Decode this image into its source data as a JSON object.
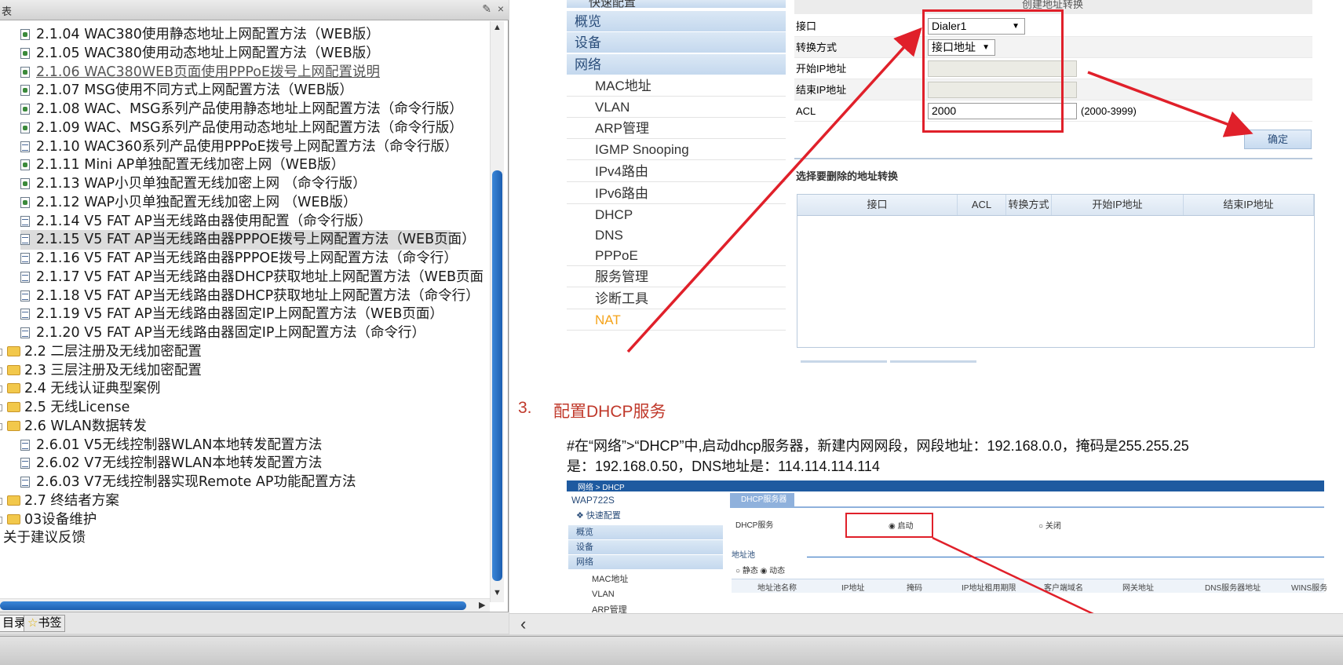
{
  "left_panel": {
    "title_fragment": "表",
    "tree": [
      {
        "label": "2.1.04 WAC380使用静态地址上网配置方法（WEB版）",
        "icon": "pdf-doc-icon",
        "level": 2
      },
      {
        "label": "2.1.05 WAC380使用动态地址上网配置方法（WEB版）",
        "icon": "pdf-doc-icon",
        "level": 2
      },
      {
        "label": "2.1.06 WAC380WEB页面使用PPPoE拨号上网配置说明",
        "icon": "pdf-doc-icon",
        "level": 2,
        "visited": true
      },
      {
        "label": "2.1.07 MSG使用不同方式上网配置方法（WEB版）",
        "icon": "pdf-doc-icon",
        "level": 2
      },
      {
        "label": "2.1.08 WAC、MSG系列产品使用静态地址上网配置方法（命令行版）",
        "icon": "pdf-doc-icon",
        "level": 2
      },
      {
        "label": "2.1.09 WAC、MSG系列产品使用动态地址上网配置方法（命令行版）",
        "icon": "pdf-doc-icon",
        "level": 2
      },
      {
        "label": "2.1.10 WAC360系列产品使用PPPoE拨号上网配置方法（命令行版）",
        "icon": "web-doc-icon",
        "level": 2
      },
      {
        "label": "2.1.11 Mini AP单独配置无线加密上网（WEB版）",
        "icon": "pdf-doc-icon",
        "level": 2
      },
      {
        "label": "2.1.13 WAP小贝单独配置无线加密上网 （命令行版）",
        "icon": "pdf-doc-icon",
        "level": 2
      },
      {
        "label": "2.1.12 WAP小贝单独配置无线加密上网 （WEB版）",
        "icon": "pdf-doc-icon",
        "level": 2
      },
      {
        "label": "2.1.14  V5 FAT AP当无线路由器使用配置（命令行版）",
        "icon": "web-doc-icon",
        "level": 2
      },
      {
        "label": "2.1.15  V5 FAT AP当无线路由器PPPOE拨号上网配置方法（WEB页面）",
        "icon": "web-doc-icon",
        "level": 2,
        "selected": true
      },
      {
        "label": "2.1.16  V5 FAT AP当无线路由器PPPOE拨号上网配置方法（命令行）",
        "icon": "web-doc-icon",
        "level": 2
      },
      {
        "label": "2.1.17  V5 FAT AP当无线路由器DHCP获取地址上网配置方法（WEB页面",
        "icon": "web-doc-icon",
        "level": 2
      },
      {
        "label": "2.1.18  V5 FAT AP当无线路由器DHCP获取地址上网配置方法（命令行）",
        "icon": "web-doc-icon",
        "level": 2
      },
      {
        "label": "2.1.19  V5 FAT AP当无线路由器固定IP上网配置方法（WEB页面）",
        "icon": "web-doc-icon",
        "level": 2
      },
      {
        "label": "2.1.20  V5 FAT AP当无线路由器固定IP上网配置方法（命令行）",
        "icon": "web-doc-icon",
        "level": 2
      },
      {
        "label": "2.2 二层注册及无线加密配置",
        "icon": "folder-icon",
        "level": 1
      },
      {
        "label": "2.3 三层注册及无线加密配置",
        "icon": "folder-icon",
        "level": 1
      },
      {
        "label": "2.4 无线认证典型案例",
        "icon": "folder-icon",
        "level": 1
      },
      {
        "label": "2.5 无线License",
        "icon": "folder-icon",
        "level": 1
      },
      {
        "label": "2.6 WLAN数据转发",
        "icon": "folder-icon",
        "level": 1
      },
      {
        "label": "2.6.01  V5无线控制器WLAN本地转发配置方法",
        "icon": "web-doc-icon",
        "level": 2
      },
      {
        "label": "2.6.02  V7无线控制器WLAN本地转发配置方法",
        "icon": "web-doc-icon",
        "level": 2
      },
      {
        "label": "2.6.03  V7无线控制器实现Remote AP功能配置方法",
        "icon": "web-doc-icon",
        "level": 2
      },
      {
        "label": "2.7 终结者方案",
        "icon": "folder-icon",
        "level": 1
      },
      {
        "label": "03设备维护",
        "icon": "folder-icon",
        "level": 0
      },
      {
        "label": "关于建议反馈",
        "icon": "",
        "level": 0
      }
    ],
    "tabs": {
      "toc": "目录",
      "bookmarks": "书签"
    }
  },
  "doc": {
    "screenshot1": {
      "quick_config": "快速配置",
      "nav": [
        {
          "label": "概览",
          "type": "group"
        },
        {
          "label": "设备",
          "type": "group"
        },
        {
          "label": "网络",
          "type": "group"
        },
        {
          "label": "MAC地址",
          "type": "sub"
        },
        {
          "label": "VLAN",
          "type": "sub"
        },
        {
          "label": "ARP管理",
          "type": "sub"
        },
        {
          "label": "IGMP Snooping",
          "type": "sub"
        },
        {
          "label": "IPv4路由",
          "type": "sub"
        },
        {
          "label": "IPv6路由",
          "type": "sub"
        },
        {
          "label": "DHCP",
          "type": "sub"
        },
        {
          "label": "DNS",
          "type": "sub"
        },
        {
          "label": "PPPoE",
          "type": "sub"
        },
        {
          "label": "服务管理",
          "type": "sub"
        },
        {
          "label": "诊断工具",
          "type": "sub"
        },
        {
          "label": "NAT",
          "type": "sub",
          "active": true
        }
      ],
      "section_title": "创建地址转换",
      "form": {
        "interface_label": "接口",
        "interface_value": "Dialer1",
        "mode_label": "转换方式",
        "mode_value": "接口地址",
        "start_ip_label": "开始IP地址",
        "end_ip_label": "结束IP地址",
        "acl_label": "ACL",
        "acl_value": "2000",
        "acl_range": "(2000-3999)",
        "confirm": "确定"
      },
      "delete_title": "选择要删除的地址转换",
      "table_headers": [
        "接口",
        "ACL",
        "转换方式",
        "开始IP地址",
        "结束IP地址"
      ]
    },
    "step": {
      "number": "3.",
      "title": "配置DHCP服务"
    },
    "paragraph_line1": "#在“网络”>“DHCP”中,启动dhcp服务器，新建内网网段，网段地址：192.168.0.0，掩码是255.255.25",
    "paragraph_line2": "是：192.168.0.50，DNS地址是：114.114.114.114",
    "screenshot2": {
      "breadcrumb": "网络 > DHCP",
      "device": "WAP722S",
      "tab": "DHCP服务器",
      "nav": [
        {
          "label": "快速配置",
          "type": "quick"
        },
        {
          "label": "概览",
          "type": "g"
        },
        {
          "label": "设备",
          "type": "g"
        },
        {
          "label": "网络",
          "type": "g"
        },
        {
          "label": "MAC地址",
          "type": "s"
        },
        {
          "label": "VLAN",
          "type": "s"
        },
        {
          "label": "ARP管理",
          "type": "s"
        }
      ],
      "dhcp_service_label": "DHCP服务",
      "enable": "启动",
      "disable": "关闭",
      "pool_label": "地址池",
      "static": "静态",
      "dynamic": "动态",
      "table_headers": [
        "地址池名称",
        "IP地址",
        "掩码",
        "IP地址租用期限",
        "客户端域名",
        "网关地址",
        "DNS服务器地址",
        "WINS服务"
      ]
    }
  },
  "colors": {
    "accent_red": "#e0202a",
    "nav_blue": "#c4d8ee",
    "scroll_blue": "#1d5fb0",
    "step_red": "#c0392b"
  }
}
